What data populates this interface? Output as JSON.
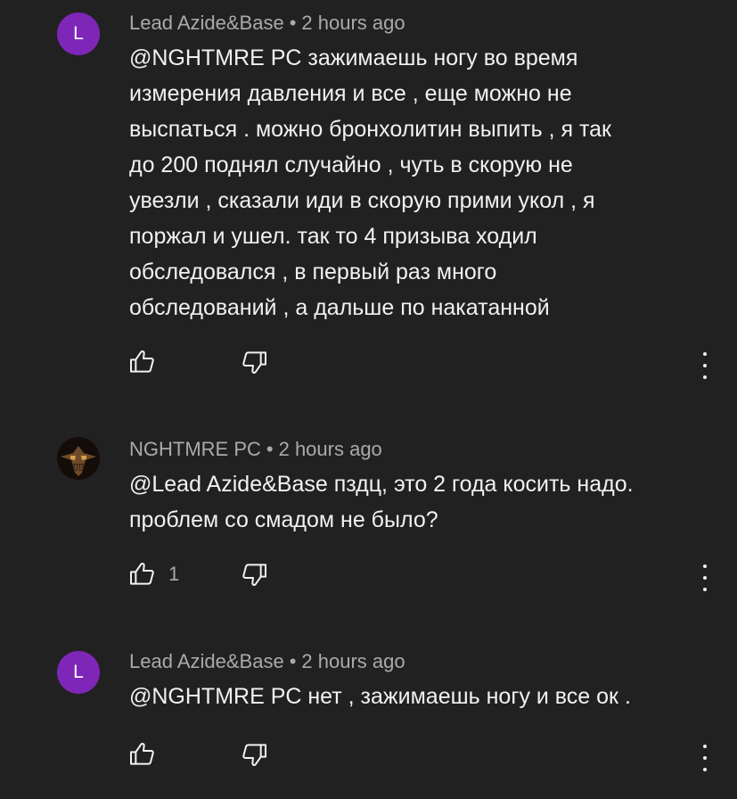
{
  "comments": [
    {
      "avatar_letter": "L",
      "avatar_color": "#7e26b8",
      "author": "Lead Azide&Base",
      "separator": "•",
      "time": "2 hours ago",
      "text": "@NGHTMRE PC зажимаешь ногу во время\nизмерения давления и все , еще можно не\nвыспаться . можно бронхолитин выпить , я так\nдо 200 поднял случайно , чуть в скорую не\nувезли , сказали иди в скорую прими укол , я\nпоржал и ушел. так то 4 призыва ходил\nобследовался , в первый раз много\nобследований , а дальше по накатанной",
      "like_count": ""
    },
    {
      "avatar_letter": "",
      "avatar_color": "",
      "author": "NGHTMRE PC",
      "separator": "•",
      "time": "2 hours ago",
      "text": "@Lead Azide&Base пздц, это 2 года косить надо.\nпроблем со смадом не было?",
      "like_count": "1"
    },
    {
      "avatar_letter": "L",
      "avatar_color": "#7e26b8",
      "author": "Lead Azide&Base",
      "separator": "•",
      "time": "2 hours ago",
      "text": "@NGHTMRE PC нет , зажимаешь ногу и все ок .",
      "like_count": ""
    }
  ],
  "icons": {
    "like": "thumb-up-icon",
    "dislike": "thumb-down-icon",
    "more": "more-vertical-icon"
  },
  "colors": {
    "background": "#212121",
    "text": "#f1f1f1",
    "meta": "#aaaaaa"
  }
}
